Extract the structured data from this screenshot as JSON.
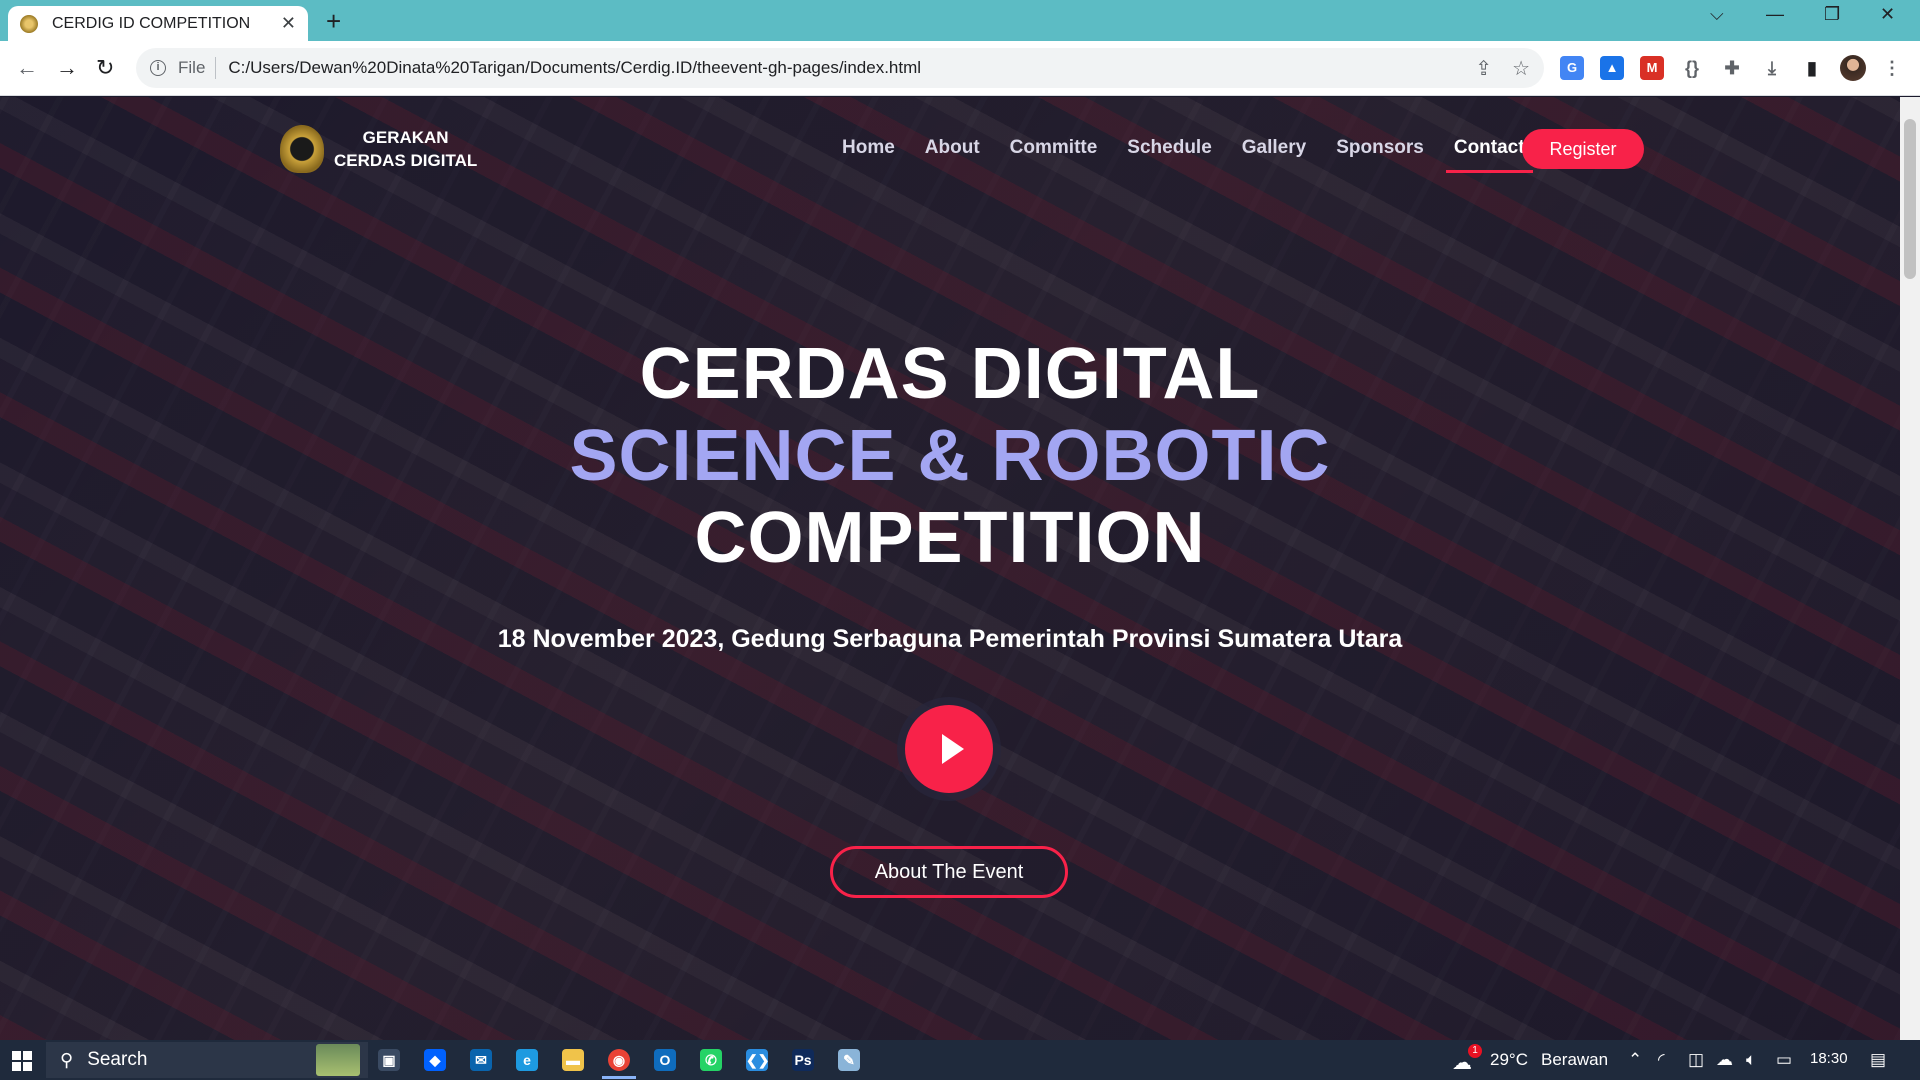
{
  "browser": {
    "tab_title": "CERDIG ID COMPETITION",
    "tab_close": "✕",
    "new_tab": "+",
    "win_controls": [
      "⌵",
      "—",
      "❐",
      "✕"
    ],
    "nav": {
      "back": "←",
      "forward": "→",
      "reload": "↻"
    },
    "address": {
      "scheme_label": "File",
      "url": "C:/Users/Dewan%20Dinata%20Tarigan/Documents/Cerdig.ID/theevent-gh-pages/index.html"
    },
    "omnibox_icons": {
      "share": "⇪",
      "bookmark": "☆"
    },
    "extensions": [
      "translate-extension",
      "graduation-extension",
      "m-extension",
      "braces-extension",
      "puzzle-icon",
      "download-icon",
      "sidepanel-icon",
      "menu-icon"
    ],
    "extension_glyphs": [
      "G",
      "▲",
      "M",
      "{}",
      "✚",
      "⤓",
      "▮",
      "⋮"
    ],
    "extension_colors": [
      "#4285f4",
      "#1a73e8",
      "#d93025",
      "#5f6368",
      "#5f6368",
      "#5f6368",
      "#202124",
      "#5f6368"
    ]
  },
  "site": {
    "logo_line1": "GERAKAN",
    "logo_line2": "CERDAS DIGITAL",
    "nav": [
      {
        "label": "Home"
      },
      {
        "label": "About"
      },
      {
        "label": "Committe"
      },
      {
        "label": "Schedule"
      },
      {
        "label": "Gallery"
      },
      {
        "label": "Sponsors"
      },
      {
        "label": "Contact"
      }
    ],
    "active_nav": "Contact",
    "register_label": "Register",
    "hero": {
      "line1": "CERDAS DIGITAL",
      "line2": "SCIENCE & ROBOTIC",
      "line3": "COMPETITION",
      "subtitle": "18 November 2023, Gedung Serbaguna Pemerintah Provinsi Sumatera Utara",
      "about_button": "About The Event"
    },
    "accent_color": "#f82249",
    "highlight_color": "#a3a6f2"
  },
  "taskbar": {
    "search_label": "Search",
    "apps": [
      "task-view-icon",
      "dropbox-icon",
      "mail-icon",
      "edge-icon",
      "file-explorer-icon",
      "chrome-icon",
      "outlook-icon",
      "whatsapp-icon",
      "vscode-icon",
      "photoshop-icon",
      "notepad-icon"
    ],
    "app_glyphs": [
      "▣",
      "◆",
      "✉",
      "e",
      "▬",
      "◉",
      "O",
      "✆",
      "❮❯",
      "Ps",
      "✎"
    ],
    "app_colors": [
      "#3a4a62",
      "#0061fe",
      "#0a64ad",
      "#1e9ae0",
      "#f0c34a",
      "#e94235",
      "#0f6cbd",
      "#25d366",
      "#2a8de0",
      "#0f2a5a",
      "#8ab4d8"
    ],
    "weather": {
      "temp": "29°C",
      "condition": "Berawan",
      "badge": "1"
    },
    "time": "18:30"
  }
}
